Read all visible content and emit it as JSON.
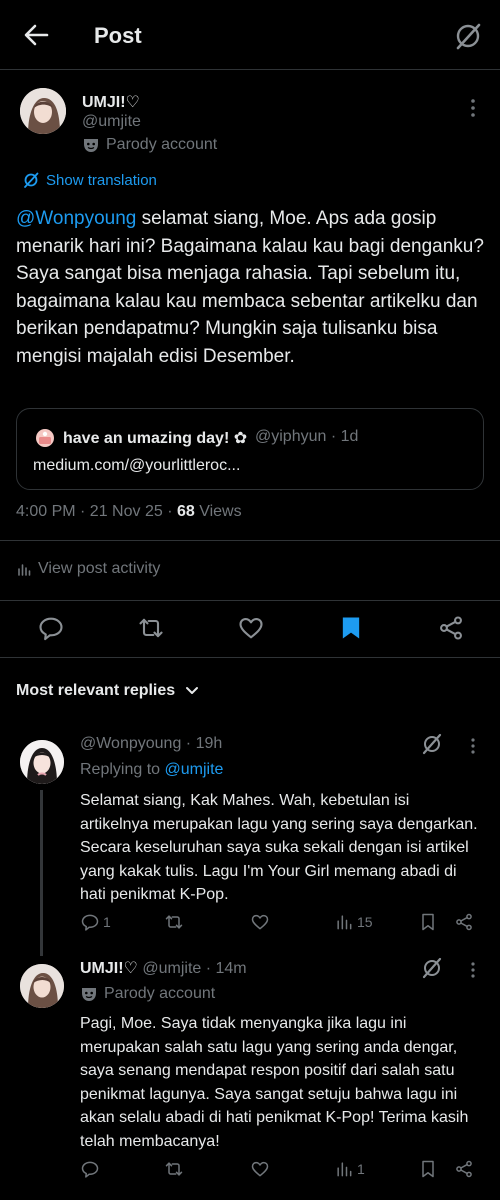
{
  "header": {
    "title": "Post"
  },
  "tweet": {
    "author_name": "UMJI!♡",
    "author_handle": "@umjite",
    "parody_label": "Parody account",
    "translate_label": "Show translation",
    "mention": "@Wonpyoung",
    "text": " selamat siang, Moe. Aps ada gosip menarik hari ini? Bagaimana kalau kau bagi denganku? Saya sangat bisa menjaga rahasia. Tapi sebelum itu, bagaimana kalau kau membaca sebentar artikelku dan berikan pendapatmu? Mungkin saja tulisanku bisa mengisi majalah edisi Desember.",
    "card": {
      "name": "have an umazing day! ✿",
      "handle": "@yiphyun",
      "age": "1d",
      "url": "medium.com/@yourlittleroc..."
    },
    "time": "4:00 PM · 21 Nov 25 · ",
    "views_count": "68",
    "views_label": " Views",
    "activity_label": "View post activity"
  },
  "sort_label": "Most relevant replies",
  "replies": [
    {
      "author_name": "",
      "author_handle": "@Wonpyoung",
      "age": "19h",
      "replying_to_label": "Replying to ",
      "replying_to_handle": "@umjite",
      "text": "Selamat siang, Kak Mahes. Wah, kebetulan isi artikelnya merupakan lagu yang sering saya dengarkan. Secara keseluruhan saya suka sekali dengan isi artikel yang kakak tulis. Lagu I'm Your Girl memang abadi di hati penikmat K-Pop.",
      "replies": "1",
      "retweets": "",
      "likes": "",
      "views": "15"
    },
    {
      "author_name": "UMJI!♡",
      "author_handle": "@umjite",
      "age": "14m",
      "parody_label": "Parody account",
      "text": "Pagi, Moe. Saya tidak menyangka jika lagu ini merupakan salah satu lagu yang sering anda dengar, saya senang mendapat respon positif dari salah satu penikmat lagunya. Saya sangat setuju bahwa lagu ini akan selalu abadi di hati penikmat K-Pop! Terima kasih telah membacanya!",
      "replies": "",
      "retweets": "",
      "likes": "",
      "views": "1"
    }
  ],
  "colors": {
    "accent": "#1d9bf0",
    "muted": "#71767b",
    "text": "#e7e9ea",
    "background": "#000000",
    "divider": "#2f3336"
  },
  "icons": [
    "back-arrow-icon",
    "grok-icon",
    "more-icon",
    "parody-mask-icon",
    "translate-globe-icon",
    "reply-icon",
    "retweet-icon",
    "like-icon",
    "bookmark-icon",
    "share-icon",
    "chart-icon",
    "chevron-down-icon"
  ]
}
